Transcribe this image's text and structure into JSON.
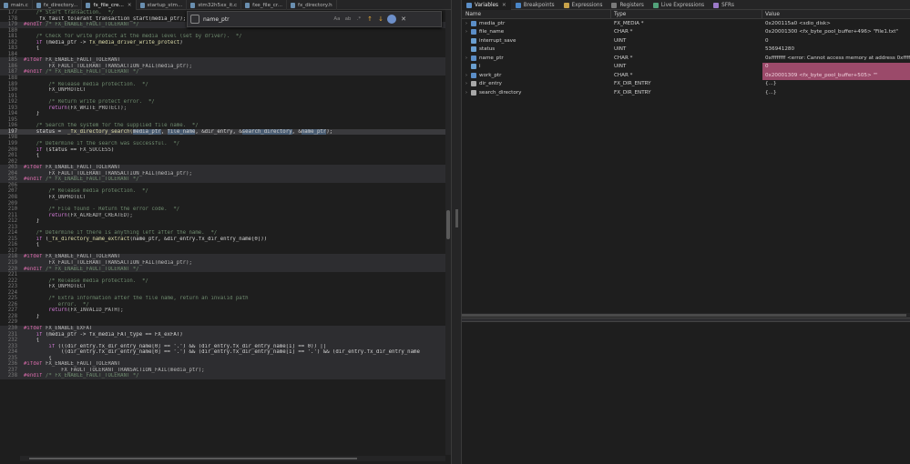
{
  "editor": {
    "tabs": [
      {
        "label": "main.c",
        "active": false
      },
      {
        "label": "fx_directory...",
        "active": false
      },
      {
        "label": "fx_file_cre...",
        "active": true
      },
      {
        "label": "startup_stm...",
        "active": false
      },
      {
        "label": "stm32h5xx_it.c",
        "active": false
      },
      {
        "label": "fxe_file_cr...",
        "active": false
      },
      {
        "label": "fx_directory.h",
        "active": false
      }
    ],
    "find": {
      "query": "name_ptr",
      "opt_case": "Aa",
      "opt_word": "ab",
      "opt_regex": ".*"
    },
    "lines": [
      {
        "n": "177",
        "cls": "",
        "toks": [
          [
            "cm",
            "    /* Start transaction.  */"
          ]
        ]
      },
      {
        "n": "178",
        "cls": "",
        "toks": [
          [
            "tx",
            "    _fx_fault_tolerant_transaction_start(media_ptr);"
          ]
        ]
      },
      {
        "n": "179",
        "cls": "shade",
        "toks": [
          [
            "pp",
            "#endif"
          ],
          [
            "cm",
            " /* FX_ENABLE_FAULT_TOLERANT */"
          ]
        ]
      },
      {
        "n": "180",
        "cls": "",
        "toks": [
          [
            "tx",
            ""
          ]
        ]
      },
      {
        "n": "181",
        "cls": "",
        "toks": [
          [
            "cm",
            "    /* Check for write protect at the media level (set by driver).  */"
          ]
        ]
      },
      {
        "n": "182",
        "cls": "",
        "toks": [
          [
            "kw",
            "    if"
          ],
          [
            "tx",
            " (media_ptr -> "
          ],
          [
            "fn",
            "fx_media_driver_write_protect"
          ],
          [
            "tx",
            ")"
          ]
        ]
      },
      {
        "n": "183",
        "cls": "",
        "toks": [
          [
            "tx",
            "    {"
          ]
        ]
      },
      {
        "n": "184",
        "cls": "",
        "toks": [
          [
            "tx",
            ""
          ]
        ]
      },
      {
        "n": "185",
        "cls": "shade",
        "toks": [
          [
            "pp",
            "#ifdef"
          ],
          [
            "mc",
            " FX_ENABLE_FAULT_TOLERANT"
          ]
        ]
      },
      {
        "n": "186",
        "cls": "shade",
        "toks": [
          [
            "mc",
            "        FX_FAULT_TOLERANT_TRANSACTION_FAIL(media_ptr);"
          ]
        ]
      },
      {
        "n": "187",
        "cls": "shade",
        "toks": [
          [
            "pp",
            "#endif"
          ],
          [
            "cm",
            " /* FX_ENABLE_FAULT_TOLERANT */"
          ]
        ]
      },
      {
        "n": "188",
        "cls": "",
        "toks": [
          [
            "tx",
            ""
          ]
        ]
      },
      {
        "n": "189",
        "cls": "",
        "toks": [
          [
            "cm",
            "        /* Release media protection.  */"
          ]
        ]
      },
      {
        "n": "190",
        "cls": "",
        "toks": [
          [
            "mc",
            "        FX_UNPROTECT"
          ]
        ]
      },
      {
        "n": "191",
        "cls": "",
        "toks": [
          [
            "tx",
            ""
          ]
        ]
      },
      {
        "n": "192",
        "cls": "",
        "toks": [
          [
            "cm",
            "        /* Return write protect error.  */"
          ]
        ]
      },
      {
        "n": "193",
        "cls": "",
        "toks": [
          [
            "kw",
            "        return"
          ],
          [
            "mc",
            "(FX_WRITE_PROTECT);"
          ]
        ]
      },
      {
        "n": "194",
        "cls": "",
        "toks": [
          [
            "tx",
            "    }"
          ]
        ]
      },
      {
        "n": "195",
        "cls": "",
        "toks": [
          [
            "tx",
            ""
          ]
        ]
      },
      {
        "n": "196",
        "cls": "",
        "toks": [
          [
            "cm",
            "    /* Search the system for the supplied file name.  */"
          ]
        ]
      },
      {
        "n": "197",
        "cls": "active",
        "toks": [
          [
            "tx",
            "    status = "
          ],
          [
            "fn",
            " _fx_directory_search("
          ],
          [
            "hl",
            "media_ptr"
          ],
          [
            "tx",
            ", "
          ],
          [
            "hl",
            "file_name"
          ],
          [
            "tx",
            ", &dir_entry, &"
          ],
          [
            "hl",
            "search_directory"
          ],
          [
            "tx",
            ", &"
          ],
          [
            "hl",
            "name_ptr"
          ],
          [
            "tx",
            ");"
          ]
        ]
      },
      {
        "n": "198",
        "cls": "",
        "toks": [
          [
            "tx",
            ""
          ]
        ]
      },
      {
        "n": "199",
        "cls": "",
        "toks": [
          [
            "cm",
            "    /* Determine if the search was successful.  */"
          ]
        ]
      },
      {
        "n": "200",
        "cls": "",
        "toks": [
          [
            "kw",
            "    if"
          ],
          [
            "tx",
            " (status == "
          ],
          [
            "mc",
            "FX_SUCCESS"
          ],
          [
            "tx",
            ")"
          ]
        ]
      },
      {
        "n": "201",
        "cls": "",
        "toks": [
          [
            "tx",
            "    {"
          ]
        ]
      },
      {
        "n": "202",
        "cls": "",
        "toks": [
          [
            "tx",
            ""
          ]
        ]
      },
      {
        "n": "203",
        "cls": "shade",
        "toks": [
          [
            "pp",
            "#ifdef"
          ],
          [
            "mc",
            " FX_ENABLE_FAULT_TOLERANT"
          ]
        ]
      },
      {
        "n": "204",
        "cls": "shade",
        "toks": [
          [
            "mc",
            "        FX_FAULT_TOLERANT_TRANSACTION_FAIL(media_ptr);"
          ]
        ]
      },
      {
        "n": "205",
        "cls": "shade",
        "toks": [
          [
            "pp",
            "#endif"
          ],
          [
            "cm",
            " /* FX_ENABLE_FAULT_TOLERANT */"
          ]
        ]
      },
      {
        "n": "206",
        "cls": "",
        "toks": [
          [
            "tx",
            ""
          ]
        ]
      },
      {
        "n": "207",
        "cls": "",
        "toks": [
          [
            "cm",
            "        /* Release media protection.  */"
          ]
        ]
      },
      {
        "n": "208",
        "cls": "",
        "toks": [
          [
            "mc",
            "        FX_UNPROTECT"
          ]
        ]
      },
      {
        "n": "209",
        "cls": "",
        "toks": [
          [
            "tx",
            ""
          ]
        ]
      },
      {
        "n": "210",
        "cls": "",
        "toks": [
          [
            "cm",
            "        /* File found - Return the error code.  */"
          ]
        ]
      },
      {
        "n": "211",
        "cls": "",
        "toks": [
          [
            "kw",
            "        return"
          ],
          [
            "mc",
            "(FX_ALREADY_CREATED);"
          ]
        ]
      },
      {
        "n": "212",
        "cls": "",
        "toks": [
          [
            "tx",
            "    }"
          ]
        ]
      },
      {
        "n": "213",
        "cls": "",
        "toks": [
          [
            "tx",
            ""
          ]
        ]
      },
      {
        "n": "214",
        "cls": "",
        "toks": [
          [
            "cm",
            "    /* Determine if there is anything left after the name.  */"
          ]
        ]
      },
      {
        "n": "215",
        "cls": "",
        "toks": [
          [
            "kw",
            "    if"
          ],
          [
            "tx",
            " ("
          ],
          [
            "fn",
            "_fx_directory_name_extract"
          ],
          [
            "tx",
            "(name_ptr, &dir_entry.fx_dir_entry_name[0]))"
          ]
        ]
      },
      {
        "n": "216",
        "cls": "",
        "toks": [
          [
            "tx",
            "    {"
          ]
        ]
      },
      {
        "n": "217",
        "cls": "",
        "toks": [
          [
            "tx",
            ""
          ]
        ]
      },
      {
        "n": "218",
        "cls": "shade",
        "toks": [
          [
            "pp",
            "#ifdef"
          ],
          [
            "mc",
            " FX_ENABLE_FAULT_TOLERANT"
          ]
        ]
      },
      {
        "n": "219",
        "cls": "shade",
        "toks": [
          [
            "mc",
            "        FX_FAULT_TOLERANT_TRANSACTION_FAIL(media_ptr);"
          ]
        ]
      },
      {
        "n": "220",
        "cls": "shade",
        "toks": [
          [
            "pp",
            "#endif"
          ],
          [
            "cm",
            " /* FX_ENABLE_FAULT_TOLERANT */"
          ]
        ]
      },
      {
        "n": "221",
        "cls": "",
        "toks": [
          [
            "tx",
            ""
          ]
        ]
      },
      {
        "n": "222",
        "cls": "",
        "toks": [
          [
            "cm",
            "        /* Release media protection.  */"
          ]
        ]
      },
      {
        "n": "223",
        "cls": "",
        "toks": [
          [
            "mc",
            "        FX_UNPROTECT"
          ]
        ]
      },
      {
        "n": "224",
        "cls": "",
        "toks": [
          [
            "tx",
            ""
          ]
        ]
      },
      {
        "n": "225",
        "cls": "",
        "toks": [
          [
            "cm",
            "        /* Extra information after the file name, return an invalid path"
          ]
        ]
      },
      {
        "n": "226",
        "cls": "",
        "toks": [
          [
            "cm",
            "           error.  */"
          ]
        ]
      },
      {
        "n": "227",
        "cls": "",
        "toks": [
          [
            "kw",
            "        return"
          ],
          [
            "mc",
            "(FX_INVALID_PATH);"
          ]
        ]
      },
      {
        "n": "228",
        "cls": "",
        "toks": [
          [
            "tx",
            "    }"
          ]
        ]
      },
      {
        "n": "229",
        "cls": "",
        "toks": [
          [
            "tx",
            ""
          ]
        ]
      },
      {
        "n": "230",
        "cls": "shade",
        "toks": [
          [
            "pp",
            "#ifdef"
          ],
          [
            "mc",
            " FX_ENABLE_EXFAT"
          ]
        ]
      },
      {
        "n": "231",
        "cls": "shade",
        "toks": [
          [
            "kw",
            "    if"
          ],
          [
            "tx",
            " (media_ptr -> fx_media_FAT_type == FX_exFAT)"
          ]
        ]
      },
      {
        "n": "232",
        "cls": "shade",
        "toks": [
          [
            "tx",
            "    {"
          ]
        ]
      },
      {
        "n": "233",
        "cls": "shade",
        "toks": [
          [
            "kw",
            "        if"
          ],
          [
            "tx",
            " (((dir_entry.fx_dir_entry_name[0] == '.') && (dir_entry.fx_dir_entry_name[1] == 0)) ||"
          ]
        ]
      },
      {
        "n": "234",
        "cls": "shade",
        "toks": [
          [
            "tx",
            "            ((dir_entry.fx_dir_entry_name[0] == '.') && (dir_entry.fx_dir_entry_name[1] == '.') && (dir_entry.fx_dir_entry_name"
          ]
        ]
      },
      {
        "n": "235",
        "cls": "shade",
        "toks": [
          [
            "tx",
            "        {"
          ]
        ]
      },
      {
        "n": "236",
        "cls": "shade",
        "toks": [
          [
            "pp",
            "#ifdef"
          ],
          [
            "mc",
            " FX_ENABLE_FAULT_TOLERANT"
          ]
        ]
      },
      {
        "n": "237",
        "cls": "shade",
        "toks": [
          [
            "mc",
            "            FX_FAULT_TOLERANT_TRANSACTION_FAIL(media_ptr);"
          ]
        ]
      },
      {
        "n": "238",
        "cls": "shade",
        "toks": [
          [
            "pp",
            "#endif"
          ],
          [
            "cm",
            " /* FX_ENABLE_FAULT_TOLERANT */"
          ]
        ]
      }
    ]
  },
  "debug_views": {
    "tabs": [
      {
        "label": "Variables",
        "icon": "variables-icon",
        "active": true,
        "closable": true
      },
      {
        "label": "Breakpoints",
        "icon": "breakpoints-icon",
        "active": false,
        "closable": false
      },
      {
        "label": "Expressions",
        "icon": "expressions-icon",
        "active": false,
        "closable": false
      },
      {
        "label": "Registers",
        "icon": "registers-icon",
        "active": false,
        "closable": false
      },
      {
        "label": "Live Expressions",
        "icon": "live-expressions-icon",
        "active": false,
        "closable": false
      },
      {
        "label": "SFRs",
        "icon": "sfrs-icon",
        "active": false,
        "closable": false
      }
    ],
    "columns": {
      "name": "Name",
      "type": "Type",
      "value": "Value"
    },
    "variables": [
      {
        "name": "media_ptr",
        "type": "FX_MEDIA *",
        "value": "0x200115a0 <sdio_disk>",
        "expandable": true,
        "kind": "ptr",
        "changed": false
      },
      {
        "name": "file_name",
        "type": "CHAR *",
        "value": "0x20001300 <fx_byte_pool_buffer+496> \"File1.txt\"",
        "expandable": true,
        "kind": "ptr",
        "changed": false
      },
      {
        "name": "interrupt_save",
        "type": "UINT",
        "value": "0",
        "expandable": false,
        "kind": "val",
        "changed": false
      },
      {
        "name": "status",
        "type": "UINT",
        "value": "536941280",
        "expandable": false,
        "kind": "val",
        "changed": false
      },
      {
        "name": "name_ptr",
        "type": "CHAR *",
        "value": "0xffffffff <error: Cannot access memory at address 0xffff...",
        "expandable": true,
        "kind": "ptr",
        "changed": false
      },
      {
        "name": "i",
        "type": "UINT",
        "value": "0",
        "expandable": false,
        "kind": "val",
        "changed": true
      },
      {
        "name": "work_ptr",
        "type": "CHAR *",
        "value": "0x20001309 <fx_byte_pool_buffer+505> \"\"",
        "expandable": true,
        "kind": "ptr",
        "changed": true
      },
      {
        "name": "dir_entry",
        "type": "FX_DIR_ENTRY",
        "value": "{...}",
        "expandable": true,
        "kind": "struct",
        "changed": false
      },
      {
        "name": "search_directory",
        "type": "FX_DIR_ENTRY",
        "value": "{...}",
        "expandable": true,
        "kind": "struct",
        "changed": false
      }
    ]
  }
}
